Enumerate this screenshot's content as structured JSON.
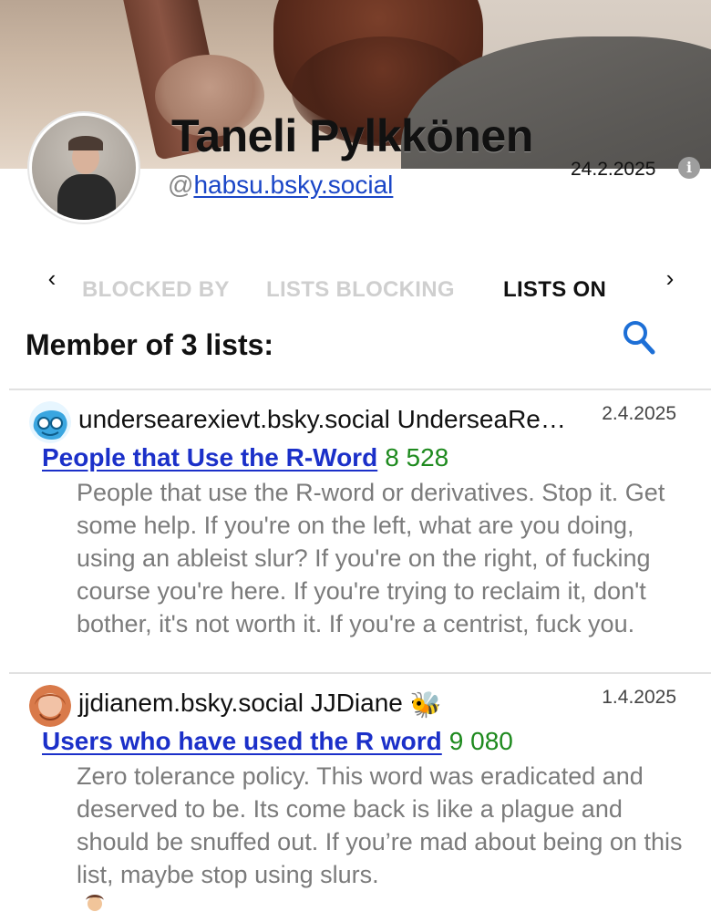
{
  "profile": {
    "display_name": "Taneli Pylkkönen",
    "handle_prefix": "@",
    "handle": "habsu.bsky.social",
    "date": "24.2.2025",
    "info_icon": "i"
  },
  "tabs": {
    "items": [
      {
        "label": "BLOCKED BY"
      },
      {
        "label": "LISTS BLOCKING"
      },
      {
        "label": "LISTS ON"
      }
    ],
    "active": "LISTS ON",
    "left_arrow": "‹",
    "right_arrow": "›"
  },
  "section": {
    "title": "Member of 3 lists:"
  },
  "lists": [
    {
      "owner_handle": "undersearexievt.bsky.social",
      "owner_name": "UnderseaRe…",
      "date": "2.4.2025",
      "title": "People that Use the R-Word",
      "count": "8 528",
      "description": "People that use the R-word or derivatives. Stop it. Get some help. If you're on the left, what are you doing, using an ableist slur? If you're on the right, of fucking course you're here. If you're trying to reclaim it, don't bother, it's not worth it. If you're a centrist, fuck you."
    },
    {
      "owner_handle": "jjdianem.bsky.social",
      "owner_name": "JJDiane",
      "owner_emoji": "🐝",
      "date": "1.4.2025",
      "title": "Users who have used the R word",
      "count": "9 080",
      "description": "Zero tolerance policy. This word was eradicated and deserved to be. Its come back is like a plague and should be snuffed out. If you’re mad about being on this list, maybe stop using slurs."
    }
  ],
  "colors": {
    "link": "#1b30c9",
    "count": "#1e8a1e",
    "description": "#7b7b7b",
    "accent_search": "#1d6fd6"
  }
}
